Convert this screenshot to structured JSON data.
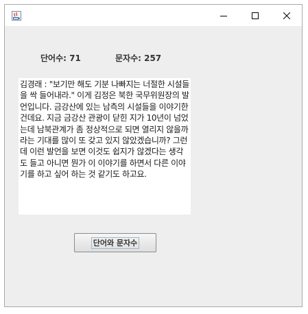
{
  "window": {
    "icon": "java-app-icon",
    "controls": {
      "minimize_icon": "minimize-icon",
      "maximize_icon": "maximize-icon",
      "close_icon": "close-icon"
    }
  },
  "stats": {
    "word_count_label": "단어수: 71",
    "char_count_label": "문자수: 257"
  },
  "text_area": {
    "value": "김경래 : \"보기만 해도 기분 나빠지는 너절한 시설들을 싹 들어내라.\" 이게 김정은 북한 국무위원장의 발언입니다. 금강산에 있는 남측의 시설들을 이야기한 건데요. 지금 금강산 관광이 닫힌 지가 10년이 넘었는데 남북관계가 좀 정상적으로 되면 열리지 않을까라는 기대를 많이 또 갖고 있지 않았겠습니까? 그런데 이런 발언을 보면 이것도 쉽지가 않겠다는 생각도 들고 아니면 뭔가 이 이야기를 하면서 다른 이야기를 하고 싶어 하는 것 같기도 하고요."
  },
  "button": {
    "label": "단어와 문자수"
  }
}
